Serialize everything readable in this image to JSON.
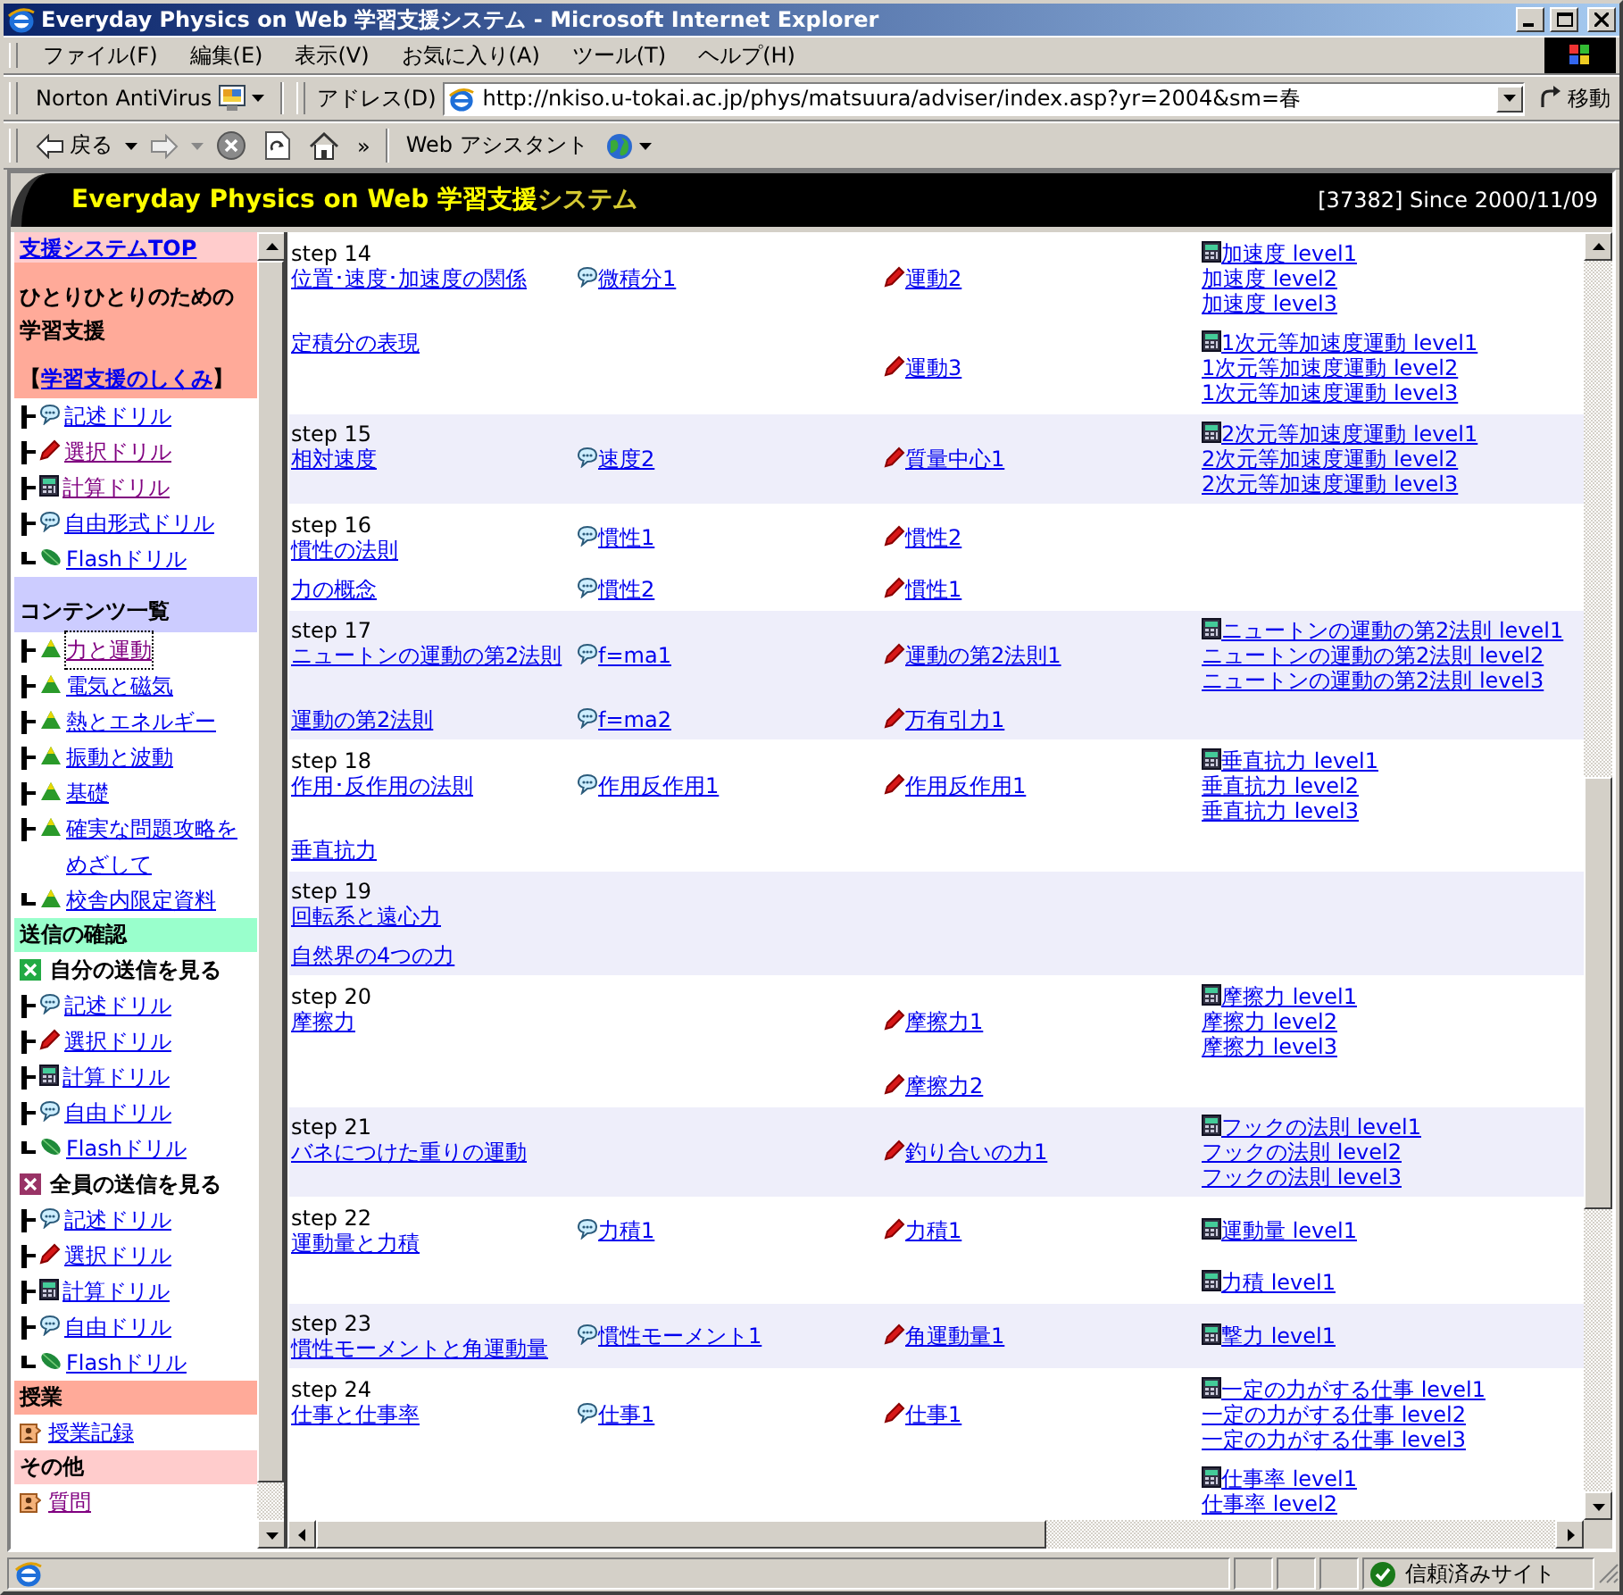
{
  "window": {
    "title": "Everyday Physics on Web 学習支援システム - Microsoft Internet Explorer"
  },
  "menu": [
    "ファイル(F)",
    "編集(E)",
    "表示(V)",
    "お気に入り(A)",
    "ツール(T)",
    "ヘルプ(H)"
  ],
  "address_bar": {
    "norton": "Norton AntiVirus",
    "label": "アドレス(D)",
    "url": "http://nkiso.u-tokai.ac.jp/phys/matsuura/adviser/index.asp?yr=2004&sm=春",
    "go": "移動"
  },
  "nav_bar": {
    "back": "戻る",
    "more": "»",
    "assistant": "Web アシスタント"
  },
  "banner": {
    "title_parts": [
      {
        "text": "Everyday Physics on Web 学習支援",
        "color": "#ffff00"
      },
      {
        "text": "システム",
        "color": "#d4c832"
      }
    ],
    "counter": "[37382] Since 2000/11/09"
  },
  "sidebar": {
    "items": [
      {
        "kind": "top-link",
        "label": "支援システムTOP",
        "color": "#ffcccc"
      },
      {
        "kind": "intro",
        "label": "ひとりひとりのための学習支援",
        "link_open": "【",
        "link": "学習支援のしくみ",
        "link_close": "】",
        "color": "#ffaa99"
      },
      {
        "kind": "bubble",
        "last": false,
        "label": "記述ドリル",
        "visited": false
      },
      {
        "kind": "pencil",
        "last": false,
        "label": "選択ドリル",
        "visited": true
      },
      {
        "kind": "calc",
        "last": false,
        "label": "計算ドリル",
        "visited": true
      },
      {
        "kind": "bubble",
        "last": false,
        "label": "自由形式ドリル",
        "visited": false
      },
      {
        "kind": "leaf",
        "last": true,
        "label": "Flashドリル",
        "visited": false
      },
      {
        "kind": "section",
        "label": "コンテンツ一覧",
        "color": "#ccccff"
      },
      {
        "kind": "tree",
        "last": false,
        "label": "力と運動",
        "visited": true,
        "focused": true
      },
      {
        "kind": "tree",
        "last": false,
        "label": "電気と磁気",
        "visited": false
      },
      {
        "kind": "tree",
        "last": false,
        "label": "熱とエネルギー",
        "visited": false
      },
      {
        "kind": "tree",
        "last": false,
        "label": "振動と波動",
        "visited": false
      },
      {
        "kind": "tree",
        "last": false,
        "label": "基礎",
        "visited": false
      },
      {
        "kind": "tree",
        "last": false,
        "label": "確実な問題攻略をめざして",
        "visited": false
      },
      {
        "kind": "tree",
        "last": true,
        "label": "校舎内限定資料",
        "visited": false
      },
      {
        "kind": "heading",
        "label": "送信の確認",
        "color": "#99ffcc"
      },
      {
        "kind": "subheading",
        "label": "自分の送信を見る",
        "color": "#22aa44"
      },
      {
        "kind": "bubble",
        "last": false,
        "label": "記述ドリル",
        "visited": false
      },
      {
        "kind": "pencil",
        "last": false,
        "label": "選択ドリル",
        "visited": false
      },
      {
        "kind": "calc",
        "last": false,
        "label": "計算ドリル",
        "visited": false
      },
      {
        "kind": "bubble",
        "last": false,
        "label": "自由ドリル",
        "visited": false
      },
      {
        "kind": "leaf",
        "last": true,
        "label": "Flashドリル",
        "visited": false
      },
      {
        "kind": "subheading",
        "label": "全員の送信を見る",
        "color": "#993366"
      },
      {
        "kind": "bubble",
        "last": false,
        "label": "記述ドリル",
        "visited": false
      },
      {
        "kind": "pencil",
        "last": false,
        "label": "選択ドリル",
        "visited": false
      },
      {
        "kind": "calc",
        "last": false,
        "label": "計算ドリル",
        "visited": false
      },
      {
        "kind": "bubble",
        "last": false,
        "label": "自由ドリル",
        "visited": false
      },
      {
        "kind": "leaf",
        "last": true,
        "label": "Flashドリル",
        "visited": false
      },
      {
        "kind": "heading",
        "label": "授業",
        "color": "#ffaa99"
      },
      {
        "kind": "doc-item",
        "label": "授業記録",
        "visited": false
      },
      {
        "kind": "heading",
        "label": "その他",
        "color": "#ffcccc"
      },
      {
        "kind": "doc-item",
        "label": "質問",
        "visited": true
      }
    ]
  },
  "steps": [
    {
      "label": "step 14",
      "rows": [
        {
          "topic": "位置･速度･加速度の関係",
          "desc": "微積分1",
          "select": "運動2",
          "calc": [
            "加速度 level1",
            "加速度 level2",
            "加速度 level3"
          ]
        },
        {
          "topic": "定積分の表現",
          "select": "運動3",
          "calc": [
            "1次元等加速度運動 level1",
            "1次元等加速度運動 level2",
            "1次元等加速度運動 level3"
          ]
        }
      ]
    },
    {
      "label": "step 15",
      "rows": [
        {
          "topic": "相対速度",
          "desc": "速度2",
          "select": "質量中心1",
          "calc": [
            "2次元等加速度運動 level1",
            "2次元等加速度運動 level2",
            "2次元等加速度運動 level3"
          ]
        }
      ]
    },
    {
      "label": "step 16",
      "rows": [
        {
          "topic": "慣性の法則",
          "desc": "慣性1",
          "select": "慣性2"
        },
        {
          "topic": "力の概念",
          "desc": "慣性2",
          "select": "慣性1"
        }
      ]
    },
    {
      "label": "step 17",
      "rows": [
        {
          "topic": "ニュートンの運動の第2法則",
          "desc": "f=ma1",
          "select": "運動の第2法則1",
          "calc": [
            "ニュートンの運動の第2法則 level1",
            "ニュートンの運動の第2法則 level2",
            "ニュートンの運動の第2法則 level3"
          ]
        },
        {
          "topic": "運動の第2法則",
          "desc": "f=ma2",
          "select": "万有引力1"
        }
      ]
    },
    {
      "label": "step 18",
      "rows": [
        {
          "topic": "作用･反作用の法則",
          "desc": "作用反作用1",
          "select": "作用反作用1",
          "calc": [
            "垂直抗力 level1",
            "垂直抗力 level2",
            "垂直抗力 level3"
          ]
        },
        {
          "topic": "垂直抗力"
        }
      ]
    },
    {
      "label": "step 19",
      "rows": [
        {
          "topic": "回転系と遠心力"
        },
        {
          "topic": "自然界の4つの力"
        }
      ]
    },
    {
      "label": "step 20",
      "rows": [
        {
          "topic": "摩擦力",
          "select": "摩擦力1",
          "calc": [
            "摩擦力 level1",
            "摩擦力 level2",
            "摩擦力 level3"
          ]
        },
        {
          "select": "摩擦力2"
        }
      ]
    },
    {
      "label": "step 21",
      "rows": [
        {
          "topic": "バネにつけた重りの運動",
          "select": "釣り合いの力1",
          "calc": [
            "フックの法則 level1",
            "フックの法則 level2",
            "フックの法則 level3"
          ]
        }
      ]
    },
    {
      "label": "step 22",
      "rows": [
        {
          "topic": "運動量と力積",
          "desc": "力積1",
          "select": "力積1",
          "calc": [
            "運動量 level1"
          ]
        },
        {
          "calc": [
            "力積 level1"
          ]
        }
      ]
    },
    {
      "label": "step 23",
      "rows": [
        {
          "topic": "慣性モーメントと角運動量",
          "desc": "慣性モーメント1",
          "select": "角運動量1",
          "calc": [
            "撃力 level1"
          ]
        }
      ]
    },
    {
      "label": "step 24",
      "rows": [
        {
          "topic": "仕事と仕事率",
          "desc": "仕事1",
          "select": "仕事1",
          "calc": [
            "一定の力がする仕事 level1",
            "一定の力がする仕事 level2",
            "一定の力がする仕事 level3"
          ]
        },
        {
          "calc": [
            "仕事率 level1",
            "仕事率 level2"
          ]
        }
      ]
    }
  ],
  "status_bar": {
    "zone": "信頼済みサイト"
  }
}
